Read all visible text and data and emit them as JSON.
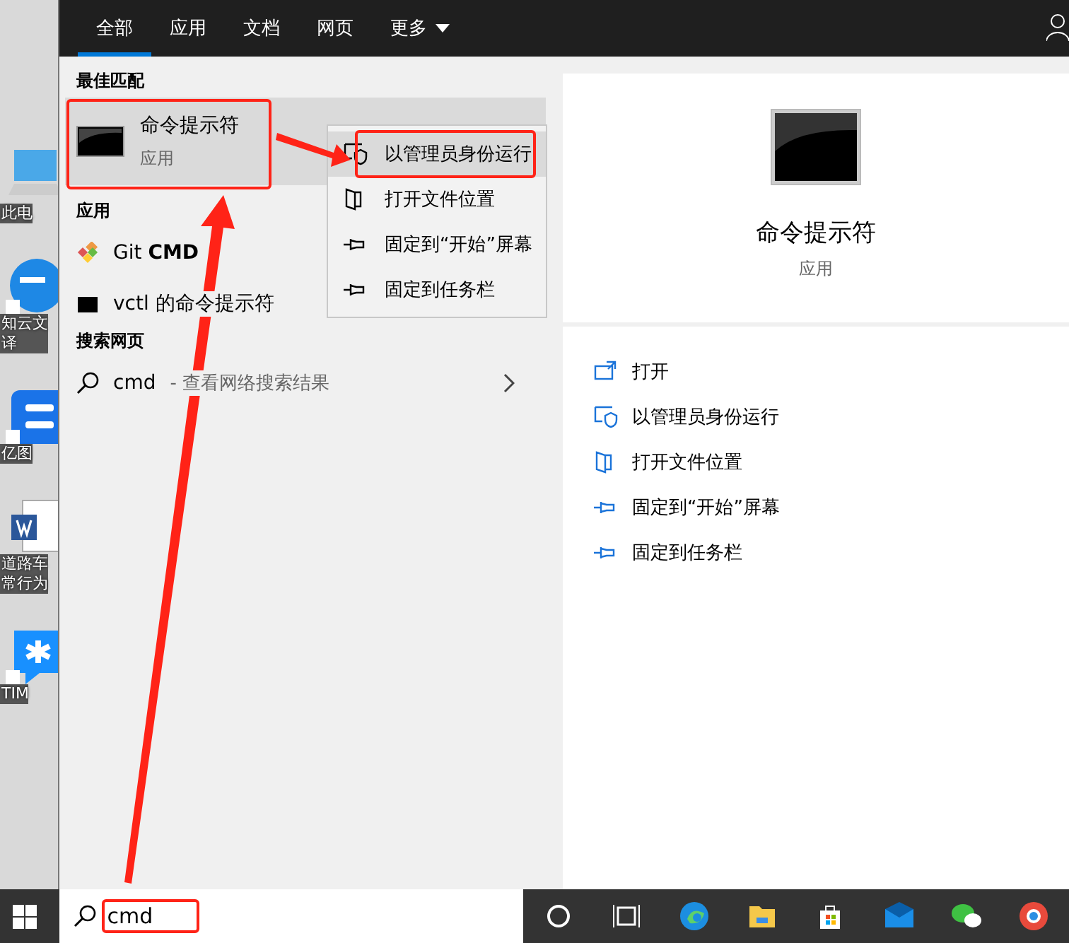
{
  "desktop_icons": [
    {
      "lines": [
        "此电"
      ]
    },
    {
      "lines": [
        "知云文",
        "译"
      ]
    },
    {
      "lines": [
        "亿图"
      ]
    },
    {
      "lines": [
        "道路车",
        "常行为"
      ]
    },
    {
      "lines": [
        "TIM"
      ]
    }
  ],
  "tabs": [
    {
      "label": "全部",
      "selected": true,
      "kind": "plain"
    },
    {
      "label": "应用",
      "selected": false,
      "kind": "plain"
    },
    {
      "label": "文档",
      "selected": false,
      "kind": "plain"
    },
    {
      "label": "网页",
      "selected": false,
      "kind": "plain"
    },
    {
      "label": "更多",
      "selected": false,
      "kind": "dropdown"
    }
  ],
  "best_match": {
    "heading": "最佳匹配",
    "name": "命令提示符",
    "type": "应用",
    "selected": true
  },
  "apps": {
    "heading": "应用",
    "items": [
      {
        "name": "Git **CMD**"
      },
      {
        "name": "vctl 的命令提示符"
      }
    ]
  },
  "web": {
    "heading": "搜索网页",
    "query": "cmd",
    "hint": "- 查看网络搜索结果"
  },
  "context_menu": [
    {
      "label": "以管理员身份运行",
      "selected": true
    },
    {
      "label": "打开文件位置",
      "selected": false
    },
    {
      "label": "固定到“开始”屏幕",
      "selected": false
    },
    {
      "label": "固定到任务栏",
      "selected": false
    }
  ],
  "detail": {
    "name": "命令提示符",
    "type": "应用",
    "actions": [
      {
        "label": "打开"
      },
      {
        "label": "以管理员身份运行"
      },
      {
        "label": "打开文件位置"
      },
      {
        "label": "固定到“开始”屏幕"
      },
      {
        "label": "固定到任务栏"
      }
    ]
  },
  "search": {
    "value": "cmd"
  }
}
